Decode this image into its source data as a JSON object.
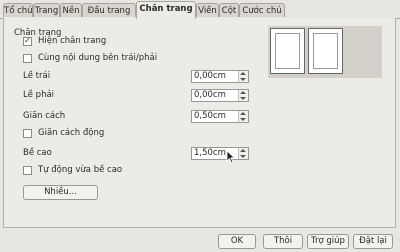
{
  "tabs": [
    {
      "label": "Tổ chức"
    },
    {
      "label": "Trang"
    },
    {
      "label": "Nền"
    },
    {
      "label": "Đầu trang"
    },
    {
      "label": "Chân trang",
      "active": true
    },
    {
      "label": "Viền"
    },
    {
      "label": "Cột"
    },
    {
      "label": "Cước chú"
    }
  ],
  "section": {
    "title": "Chân trang"
  },
  "checkboxes": {
    "show_footer": {
      "label": "Hiện chân trang",
      "checked": true
    },
    "same_content": {
      "label": "Cùng nội dung bên trái/phải",
      "checked": false
    },
    "dynamic_spacing": {
      "label": "Giãn cách động",
      "checked": false
    },
    "autofit_height": {
      "label": "Tự động vừa bề cao",
      "checked": false
    }
  },
  "fields": {
    "left_margin": {
      "label": "Lề trái",
      "value": "0,00cm"
    },
    "right_margin": {
      "label": "Lề phải",
      "value": "0,00cm"
    },
    "spacing": {
      "label": "Giãn cách",
      "value": "0,50cm"
    },
    "height": {
      "label": "Bề cao",
      "value": "1,50cm"
    }
  },
  "buttons": {
    "more": "Nhiều...",
    "ok": "OK",
    "cancel": "Thôi",
    "help": "Trợ giúp",
    "reset": "Đặt lại"
  }
}
